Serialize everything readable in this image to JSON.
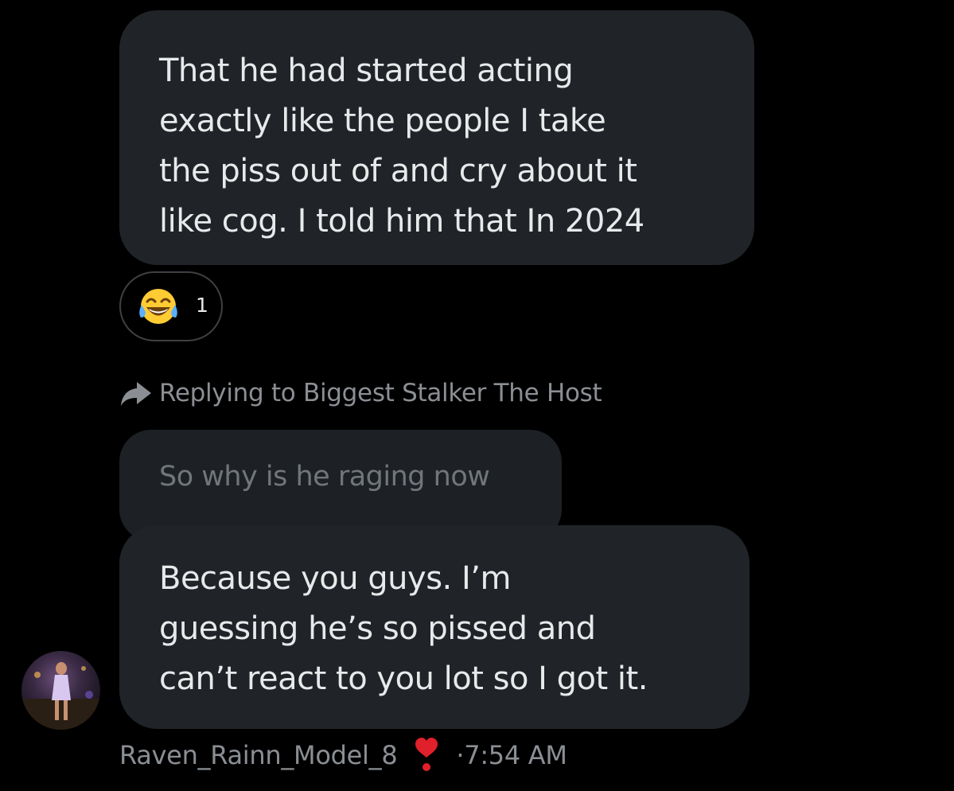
{
  "messages": [
    {
      "text": "That he had started acting\nexactly like the people I take\nthe piss out of and cry about it\nlike cog. I told him that In 2024"
    },
    {
      "text": "So why is he raging now"
    },
    {
      "text": "Because you guys. I’m\nguessing he’s so pissed and\ncan’t react to you lot so I got it."
    }
  ],
  "reaction": {
    "icon": "joy-emoji-icon",
    "count": "1"
  },
  "reply_context": {
    "icon": "reply-arrow-icon",
    "text": "Replying to Biggest Stalker The Host"
  },
  "footer": {
    "username": "Raven_Rainn_Model_8",
    "badge_icon": "heart-exclamation-icon",
    "separator": " · ",
    "time": "7:54 AM"
  },
  "colors": {
    "background": "#000000",
    "bubble": "#202327",
    "text": "#e7e9ea",
    "muted": "#8b8f94"
  }
}
